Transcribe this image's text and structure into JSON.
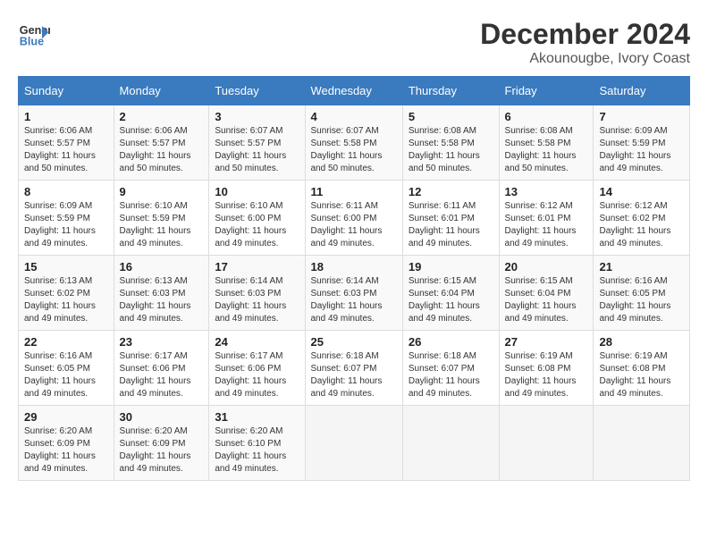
{
  "header": {
    "logo_line1": "General",
    "logo_line2": "Blue",
    "month": "December 2024",
    "location": "Akounougbe, Ivory Coast"
  },
  "weekdays": [
    "Sunday",
    "Monday",
    "Tuesday",
    "Wednesday",
    "Thursday",
    "Friday",
    "Saturday"
  ],
  "weeks": [
    [
      {
        "day": "1",
        "sunrise": "6:06 AM",
        "sunset": "5:57 PM",
        "daylight": "11 hours and 50 minutes."
      },
      {
        "day": "2",
        "sunrise": "6:06 AM",
        "sunset": "5:57 PM",
        "daylight": "11 hours and 50 minutes."
      },
      {
        "day": "3",
        "sunrise": "6:07 AM",
        "sunset": "5:57 PM",
        "daylight": "11 hours and 50 minutes."
      },
      {
        "day": "4",
        "sunrise": "6:07 AM",
        "sunset": "5:58 PM",
        "daylight": "11 hours and 50 minutes."
      },
      {
        "day": "5",
        "sunrise": "6:08 AM",
        "sunset": "5:58 PM",
        "daylight": "11 hours and 50 minutes."
      },
      {
        "day": "6",
        "sunrise": "6:08 AM",
        "sunset": "5:58 PM",
        "daylight": "11 hours and 50 minutes."
      },
      {
        "day": "7",
        "sunrise": "6:09 AM",
        "sunset": "5:59 PM",
        "daylight": "11 hours and 49 minutes."
      }
    ],
    [
      {
        "day": "8",
        "sunrise": "6:09 AM",
        "sunset": "5:59 PM",
        "daylight": "11 hours and 49 minutes."
      },
      {
        "day": "9",
        "sunrise": "6:10 AM",
        "sunset": "5:59 PM",
        "daylight": "11 hours and 49 minutes."
      },
      {
        "day": "10",
        "sunrise": "6:10 AM",
        "sunset": "6:00 PM",
        "daylight": "11 hours and 49 minutes."
      },
      {
        "day": "11",
        "sunrise": "6:11 AM",
        "sunset": "6:00 PM",
        "daylight": "11 hours and 49 minutes."
      },
      {
        "day": "12",
        "sunrise": "6:11 AM",
        "sunset": "6:01 PM",
        "daylight": "11 hours and 49 minutes."
      },
      {
        "day": "13",
        "sunrise": "6:12 AM",
        "sunset": "6:01 PM",
        "daylight": "11 hours and 49 minutes."
      },
      {
        "day": "14",
        "sunrise": "6:12 AM",
        "sunset": "6:02 PM",
        "daylight": "11 hours and 49 minutes."
      }
    ],
    [
      {
        "day": "15",
        "sunrise": "6:13 AM",
        "sunset": "6:02 PM",
        "daylight": "11 hours and 49 minutes."
      },
      {
        "day": "16",
        "sunrise": "6:13 AM",
        "sunset": "6:03 PM",
        "daylight": "11 hours and 49 minutes."
      },
      {
        "day": "17",
        "sunrise": "6:14 AM",
        "sunset": "6:03 PM",
        "daylight": "11 hours and 49 minutes."
      },
      {
        "day": "18",
        "sunrise": "6:14 AM",
        "sunset": "6:03 PM",
        "daylight": "11 hours and 49 minutes."
      },
      {
        "day": "19",
        "sunrise": "6:15 AM",
        "sunset": "6:04 PM",
        "daylight": "11 hours and 49 minutes."
      },
      {
        "day": "20",
        "sunrise": "6:15 AM",
        "sunset": "6:04 PM",
        "daylight": "11 hours and 49 minutes."
      },
      {
        "day": "21",
        "sunrise": "6:16 AM",
        "sunset": "6:05 PM",
        "daylight": "11 hours and 49 minutes."
      }
    ],
    [
      {
        "day": "22",
        "sunrise": "6:16 AM",
        "sunset": "6:05 PM",
        "daylight": "11 hours and 49 minutes."
      },
      {
        "day": "23",
        "sunrise": "6:17 AM",
        "sunset": "6:06 PM",
        "daylight": "11 hours and 49 minutes."
      },
      {
        "day": "24",
        "sunrise": "6:17 AM",
        "sunset": "6:06 PM",
        "daylight": "11 hours and 49 minutes."
      },
      {
        "day": "25",
        "sunrise": "6:18 AM",
        "sunset": "6:07 PM",
        "daylight": "11 hours and 49 minutes."
      },
      {
        "day": "26",
        "sunrise": "6:18 AM",
        "sunset": "6:07 PM",
        "daylight": "11 hours and 49 minutes."
      },
      {
        "day": "27",
        "sunrise": "6:19 AM",
        "sunset": "6:08 PM",
        "daylight": "11 hours and 49 minutes."
      },
      {
        "day": "28",
        "sunrise": "6:19 AM",
        "sunset": "6:08 PM",
        "daylight": "11 hours and 49 minutes."
      }
    ],
    [
      {
        "day": "29",
        "sunrise": "6:20 AM",
        "sunset": "6:09 PM",
        "daylight": "11 hours and 49 minutes."
      },
      {
        "day": "30",
        "sunrise": "6:20 AM",
        "sunset": "6:09 PM",
        "daylight": "11 hours and 49 minutes."
      },
      {
        "day": "31",
        "sunrise": "6:20 AM",
        "sunset": "6:10 PM",
        "daylight": "11 hours and 49 minutes."
      },
      null,
      null,
      null,
      null
    ]
  ]
}
